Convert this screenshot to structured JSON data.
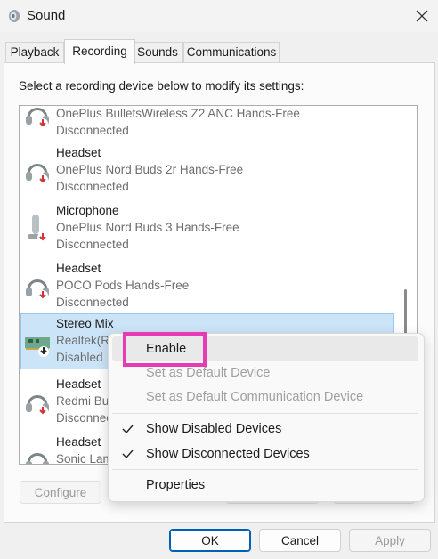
{
  "window": {
    "title": "Sound",
    "close_icon": "close-icon",
    "app_icon": "speaker-icon"
  },
  "tabs": [
    {
      "label": "Playback"
    },
    {
      "label": "Recording"
    },
    {
      "label": "Sounds"
    },
    {
      "label": "Communications"
    }
  ],
  "active_tab": "Recording",
  "instruction": "Select a recording device below to modify its settings:",
  "devices": [
    {
      "name": "",
      "description": "OnePlus BulletsWireless Z2 ANC Hands-Free",
      "status": "Disconnected",
      "icon": "headset-icon"
    },
    {
      "name": "Headset",
      "description": "OnePlus Nord Buds 2r Hands-Free",
      "status": "Disconnected",
      "icon": "headset-icon"
    },
    {
      "name": "Microphone",
      "description": "OnePlus Nord Buds 3 Hands-Free",
      "status": "Disconnected",
      "icon": "microphone-icon"
    },
    {
      "name": "Headset",
      "description": "POCO Pods Hands-Free",
      "status": "Disconnected",
      "icon": "headset-icon"
    },
    {
      "name": "Stereo Mix",
      "description": "Realtek(R)",
      "status": "Disabled",
      "icon": "sound-card-icon",
      "selected": true
    },
    {
      "name": "Headset",
      "description": "Redmi Bud",
      "status": "Disconnected",
      "icon": "headset-icon"
    },
    {
      "name": "Headset",
      "description": "Sonic Lam",
      "status": "",
      "icon": "headset-icon"
    }
  ],
  "buttons": {
    "configure": "Configure",
    "ok": "OK",
    "cancel": "Cancel",
    "apply": "Apply"
  },
  "context_menu": {
    "items": [
      {
        "label": "Enable",
        "enabled": true
      },
      {
        "label": "Set as Default Device",
        "enabled": false
      },
      {
        "label": "Set as Default Communication Device",
        "enabled": false
      },
      {
        "label": "Show Disabled Devices",
        "checked": true
      },
      {
        "label": "Show Disconnected Devices",
        "checked": true
      },
      {
        "label": "Properties",
        "enabled": true
      }
    ]
  },
  "colors": {
    "highlight_box": "#e83ab3",
    "selection": "#cce4f7",
    "primary_border": "#005fb8",
    "disconnected_badge": "#d13438"
  }
}
